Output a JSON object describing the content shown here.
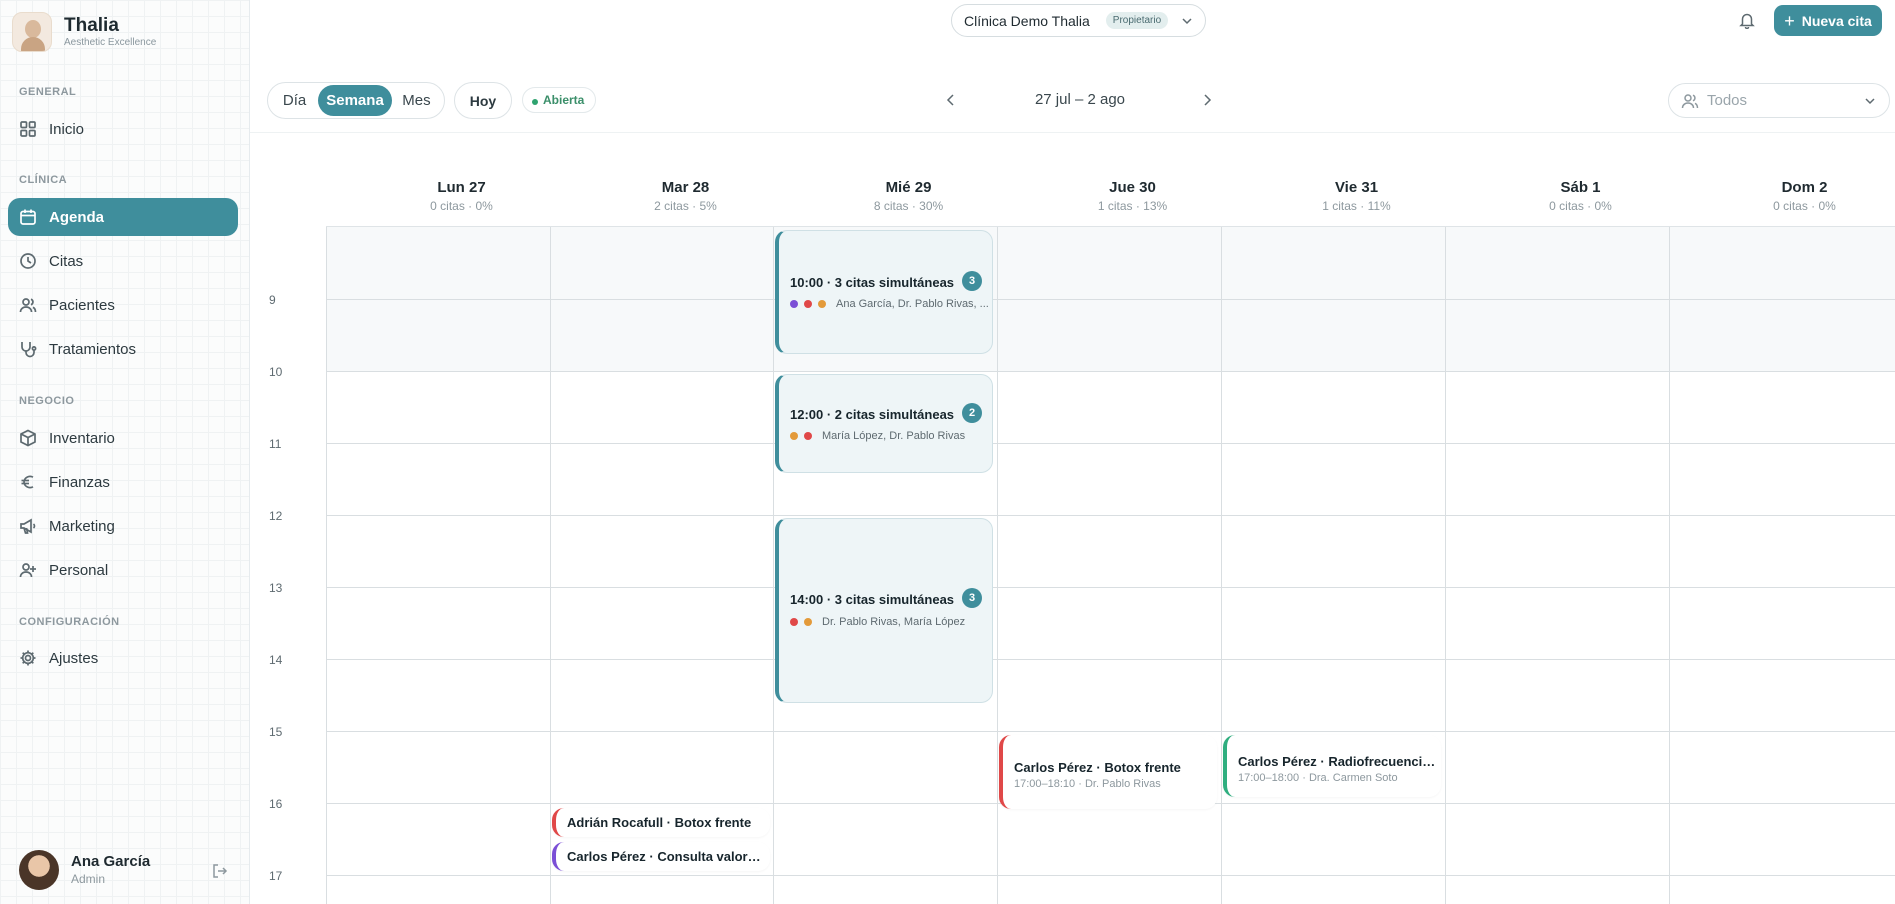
{
  "brand": {
    "name": "Thalia",
    "subtitle": "Aesthetic Excellence"
  },
  "sidebar": {
    "sections": {
      "general": "GENERAL",
      "clinica": "CLÍNICA",
      "negocio": "NEGOCIO",
      "configuracion": "CONFIGURACIÓN"
    },
    "items": [
      {
        "label": "Inicio",
        "icon": "grid-icon"
      },
      {
        "label": "Agenda",
        "icon": "calendar-icon",
        "active": true
      },
      {
        "label": "Citas",
        "icon": "clock-icon"
      },
      {
        "label": "Pacientes",
        "icon": "users-icon"
      },
      {
        "label": "Tratamientos",
        "icon": "stethoscope-icon"
      },
      {
        "label": "Inventario",
        "icon": "box-icon"
      },
      {
        "label": "Finanzas",
        "icon": "euro-icon"
      },
      {
        "label": "Marketing",
        "icon": "megaphone-icon"
      },
      {
        "label": "Personal",
        "icon": "user-plus-icon"
      },
      {
        "label": "Ajustes",
        "icon": "gear-icon"
      }
    ]
  },
  "user": {
    "name": "Ana García",
    "role": "Admin"
  },
  "topbar": {
    "clinic": "Clínica Demo Thalia",
    "role_badge": "Propietario",
    "new_button": "Nueva cita"
  },
  "toolbar": {
    "views": {
      "day": "Día",
      "week": "Semana",
      "month": "Mes"
    },
    "today": "Hoy",
    "status": "Abierta",
    "range": "27 jul – 2 ago",
    "filter_placeholder": "Todos"
  },
  "days": [
    {
      "name": "Lun 27",
      "stats": "0 citas · 0%"
    },
    {
      "name": "Mar 28",
      "stats": "2 citas · 5%"
    },
    {
      "name": "Mié 29",
      "stats": "8 citas · 30%"
    },
    {
      "name": "Jue 30",
      "stats": "1 citas · 13%"
    },
    {
      "name": "Vie 31",
      "stats": "1 citas · 11%"
    },
    {
      "name": "Sáb 1",
      "stats": "0 citas · 0%"
    },
    {
      "name": "Dom 2",
      "stats": "0 citas · 0%"
    }
  ],
  "hours": [
    "9",
    "10",
    "11",
    "12",
    "13",
    "14",
    "15",
    "16",
    "17"
  ],
  "groups": [
    {
      "title": "10:00 · 3 citas simultáneas",
      "count": "3",
      "people": "Ana García, Dr. Pablo Rivas, ...",
      "dots": [
        "#7b4fd6",
        "#e04848",
        "#e39a3a"
      ]
    },
    {
      "title": "12:00 · 2 citas simultáneas",
      "count": "2",
      "people": "María López, Dr. Pablo Rivas",
      "dots": [
        "#e39a3a",
        "#e04848"
      ]
    },
    {
      "title": "14:00 · 3 citas simultáneas",
      "count": "3",
      "people": "Dr. Pablo Rivas, María López",
      "dots": [
        "#e04848",
        "#e39a3a"
      ]
    }
  ],
  "appointments": [
    {
      "title": "Carlos Pérez · Botox frente",
      "sub": "17:00–18:10 · Dr. Pablo Rivas",
      "color": "#e04848"
    },
    {
      "title": "Carlos Pérez · Radiofrecuencia corporal",
      "sub": "17:00–18:00 · Dra. Carmen Soto",
      "color": "#2fae7f"
    },
    {
      "title": "Adrián Rocafull · Botox frente",
      "color": "#e04848"
    },
    {
      "title": "Carlos Pérez · Consulta valoración",
      "color": "#7b4fd6"
    }
  ]
}
